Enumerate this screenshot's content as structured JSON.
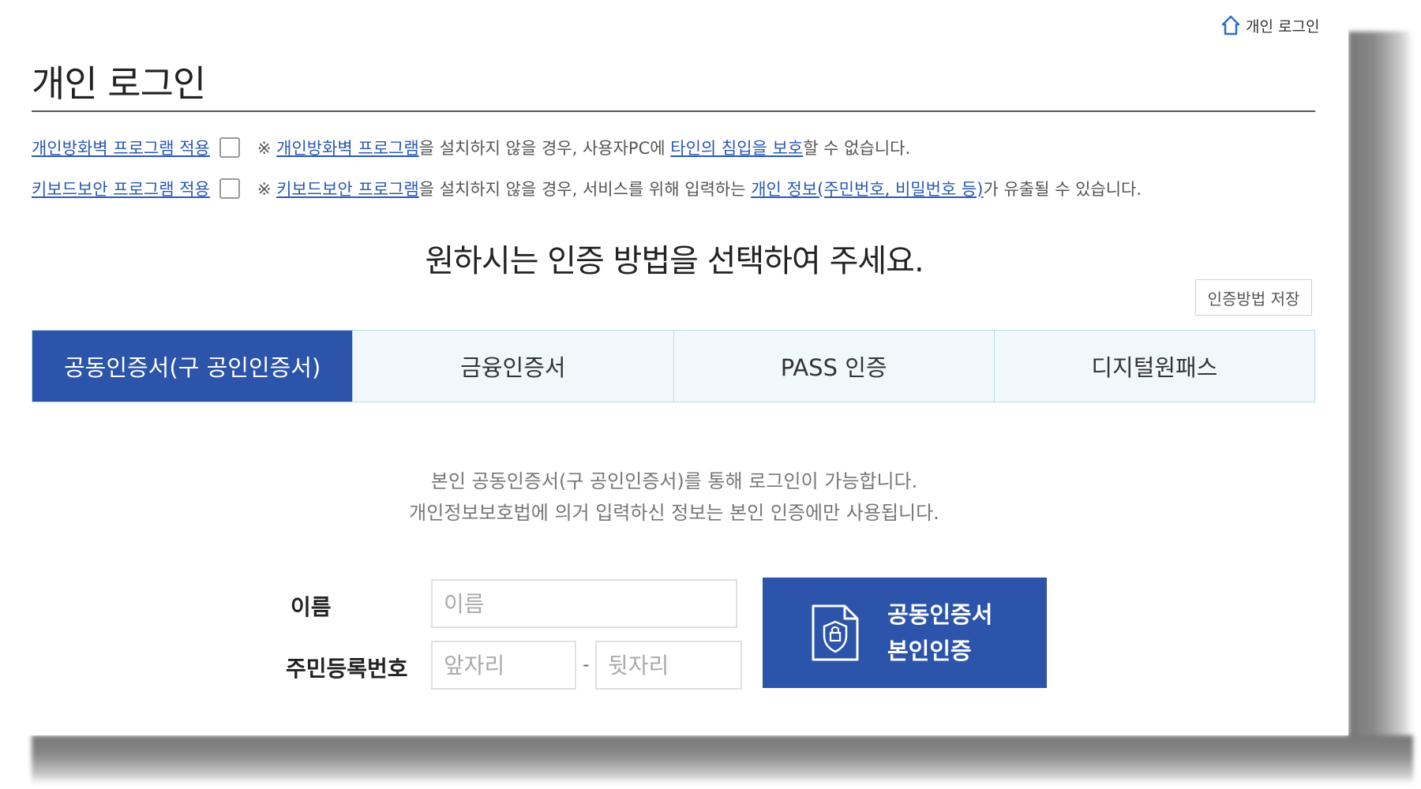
{
  "header": {
    "home_link_label": "개인 로그인",
    "page_title": "개인 로그인"
  },
  "options": [
    {
      "label": "개인방화벽 프로그램 적용",
      "checked": false,
      "note_parts": [
        {
          "text": "※ ",
          "highlight": false
        },
        {
          "text": "개인방화벽 프로그램",
          "highlight": true
        },
        {
          "text": "을 설치하지 않을 경우, 사용자PC에 ",
          "highlight": false
        },
        {
          "text": "타인의 침입을 보호",
          "highlight": true
        },
        {
          "text": "할 수 없습니다.",
          "highlight": false
        }
      ]
    },
    {
      "label": "키보드보안 프로그램 적용",
      "checked": false,
      "note_parts": [
        {
          "text": "※ ",
          "highlight": false
        },
        {
          "text": "키보드보안 프로그램",
          "highlight": true
        },
        {
          "text": "을 설치하지 않을 경우, 서비스를 위해 입력하는 ",
          "highlight": false
        },
        {
          "text": "개인 정보(주민번호, 비밀번호 등)",
          "highlight": true
        },
        {
          "text": "가 유출될 수 있습니다.",
          "highlight": false
        }
      ]
    }
  ],
  "prompt": "원하시는 인증 방법을 선택하여 주세요.",
  "save_method_label": "인증방법 저장",
  "tabs": [
    {
      "label": "공동인증서(구 공인인증서)",
      "active": true
    },
    {
      "label": "금융인증서",
      "active": false
    },
    {
      "label": "PASS 인증",
      "active": false
    },
    {
      "label": "디지털원패스",
      "active": false
    }
  ],
  "description": {
    "line1": "본인 공동인증서(구 공인인증서)를 통해 로그인이 가능합니다.",
    "line2": "개인정보보호법에 의거 입력하신 정보는 본인 인증에만 사용됩니다."
  },
  "form": {
    "name_label": "이름",
    "name_placeholder": "이름",
    "name_value": "",
    "rrn_label": "주민등록번호",
    "rrn_front_placeholder": "앞자리",
    "rrn_back_placeholder": "뒷자리",
    "rrn_separator": "-"
  },
  "auth_button": {
    "line1": "공동인증서",
    "line2": "본인인증",
    "icon": "certificate-document-icon"
  },
  "colors": {
    "accent": "#2b54aa",
    "link": "#2a58b5",
    "tab_inactive_bg": "#f1f8fc",
    "tab_border": "#b9dbea"
  }
}
